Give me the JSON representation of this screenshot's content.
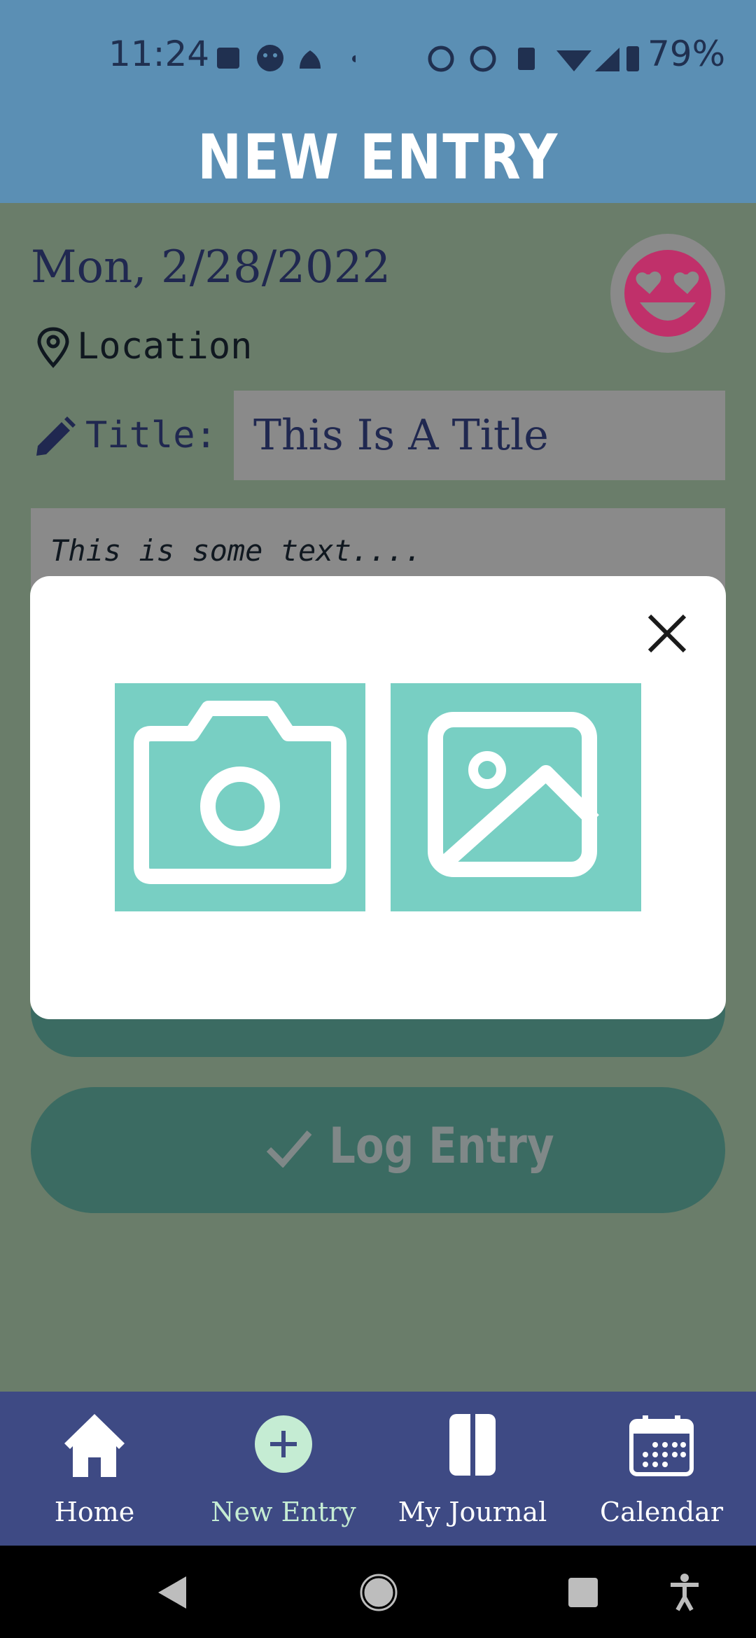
{
  "status": {
    "time": "11:24",
    "battery": "79%"
  },
  "header": {
    "title": "NEW ENTRY"
  },
  "entry": {
    "date": "Mon, 2/28/2022",
    "location": "Location",
    "title_label": "Title:",
    "title_value": "This Is A Title",
    "text": "This is some text....",
    "log_button": "Log Entry"
  },
  "modal": {
    "options": [
      "camera-icon",
      "image-icon"
    ]
  },
  "nav": {
    "items": [
      {
        "label": "Home",
        "icon": "home-icon"
      },
      {
        "label": "New Entry",
        "icon": "plus-circle-icon"
      },
      {
        "label": "My Journal",
        "icon": "journal-icon"
      },
      {
        "label": "Calendar",
        "icon": "calendar-icon"
      }
    ]
  },
  "colors": {
    "header": "#5b8fb4",
    "nav": "#3e4a84",
    "accent": "#78cfc3",
    "mood": "#c0306a"
  }
}
